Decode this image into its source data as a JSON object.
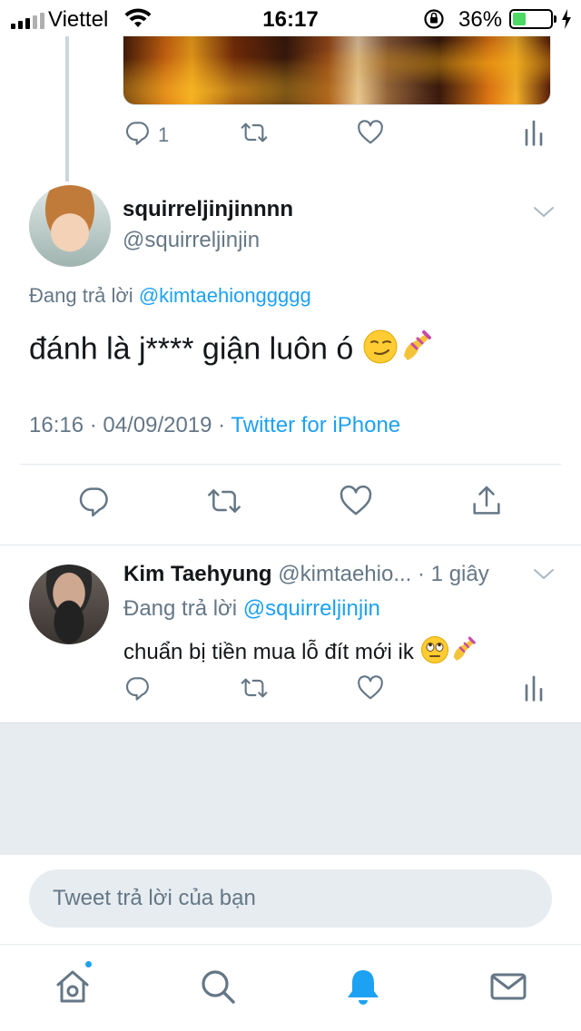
{
  "status_bar": {
    "carrier": "Viettel",
    "time": "16:17",
    "battery_percent": "36%",
    "battery_level": 0.36
  },
  "previous_tweet": {
    "reply_count": "1"
  },
  "focused_tweet": {
    "display_name": "squirreljinjinnnn",
    "handle": "@squirreljinjin",
    "replying_label": "Đang trả lời",
    "replying_to": "@kimtaehionggggg",
    "text": "đánh là j**** giận luôn ó",
    "timestamp": "16:16 · 04/09/2019 · ",
    "source": "Twitter for iPhone"
  },
  "reply_tweet": {
    "display_name": "Kim Taehyung",
    "handle": "@kimtaehio...",
    "time": " · 1 giây",
    "replying_label": "Đang trả lời",
    "replying_to": "@squirreljinjin",
    "text": "chuẩn bị tiền mua lỗ đít mới ik"
  },
  "composer": {
    "placeholder": "Tweet trả lời của bạn"
  },
  "tab_bar": {
    "items": [
      "home-icon",
      "search-icon",
      "notifications-icon",
      "messages-icon"
    ],
    "active": "notifications-icon"
  },
  "colors": {
    "accent": "#1da1f2",
    "muted": "#657786",
    "text": "#14171a",
    "battery": "#4cd964"
  }
}
